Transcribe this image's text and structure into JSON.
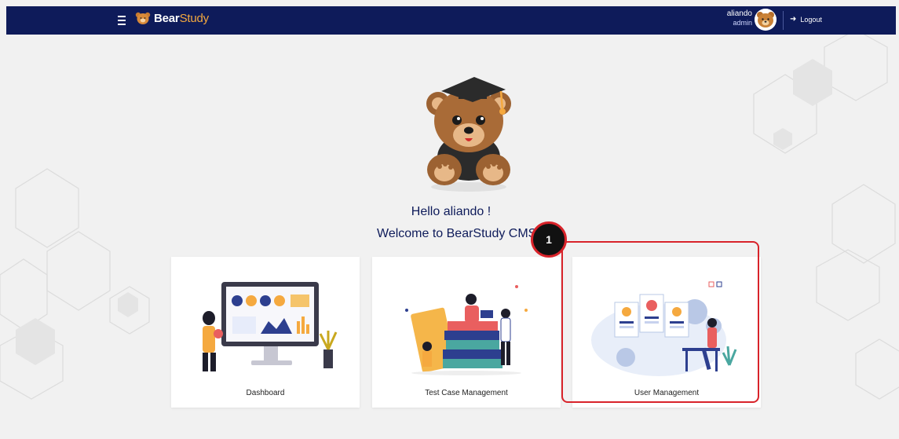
{
  "brand": {
    "name_bold": "Bear",
    "name_light": "Study"
  },
  "user": {
    "name": "aliando",
    "role": "admin"
  },
  "header": {
    "logout_label": "Logout"
  },
  "greeting": {
    "hello": "Hello aliando !",
    "welcome": "Welcome to BearStudy CMS"
  },
  "cards": [
    {
      "label": "Dashboard",
      "illustration": "dashboard-illustration"
    },
    {
      "label": "Test Case Management",
      "illustration": "test-case-illustration"
    },
    {
      "label": "User Management",
      "illustration": "user-management-illustration"
    }
  ],
  "annotation": {
    "step": "1",
    "color": "#d8232a"
  },
  "colors": {
    "navy": "#0e1b5a",
    "accent": "#f5a93f",
    "background": "#f1f1f1"
  }
}
